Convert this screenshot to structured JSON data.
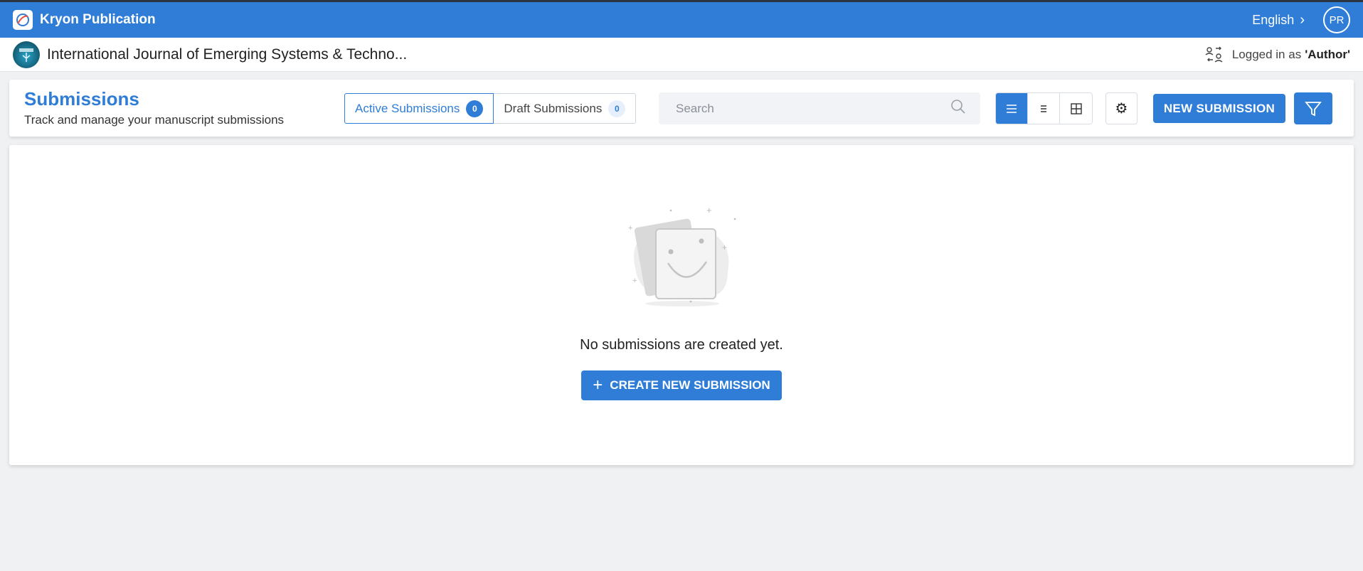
{
  "app": {
    "brand_name": "Kryon Publication",
    "language": "English",
    "avatar_initials": "PR"
  },
  "journal": {
    "title": "International Journal of Emerging Systems & Techno...",
    "logged_in_prefix": "Logged in as",
    "role": "'Author'"
  },
  "header": {
    "title": "Submissions",
    "subtitle": "Track and manage your manuscript submissions",
    "tabs": [
      {
        "label": "Active Submissions",
        "count": "0"
      },
      {
        "label": "Draft Submissions",
        "count": "0"
      }
    ],
    "search_placeholder": "Search",
    "new_submission_label": "NEW SUBMISSION"
  },
  "empty": {
    "message": "No submissions are created yet.",
    "create_label": "CREATE NEW SUBMISSION"
  },
  "colors": {
    "primary": "#2f7dd6",
    "background": "#f0f1f3"
  }
}
